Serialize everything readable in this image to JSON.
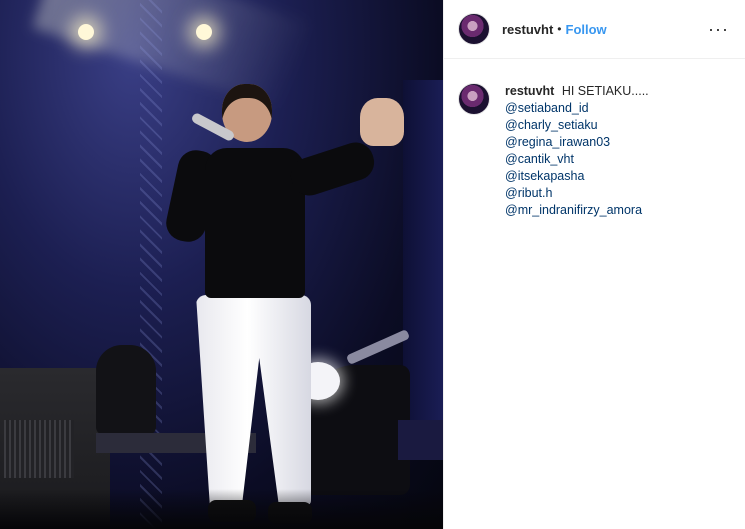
{
  "post": {
    "image": {
      "alt": ""
    },
    "header": {
      "username": "restuvht",
      "separator": "•",
      "follow_label": "Follow",
      "more_glyph": "···"
    },
    "caption": {
      "username": "restuvht",
      "text": "HI SETIAKU.....",
      "first_mention": "@setiaband_id",
      "mentions": [
        "@charly_setiaku",
        "@regina_irawan03",
        "@cantik_vht",
        "@itsekapasha",
        "@ribut.h",
        "@mr_indranifirzy_amora"
      ]
    }
  },
  "colors": {
    "link_blue": "#3897f0",
    "mention_blue": "#003569",
    "text_dark": "#262626",
    "border": "#efefef"
  }
}
